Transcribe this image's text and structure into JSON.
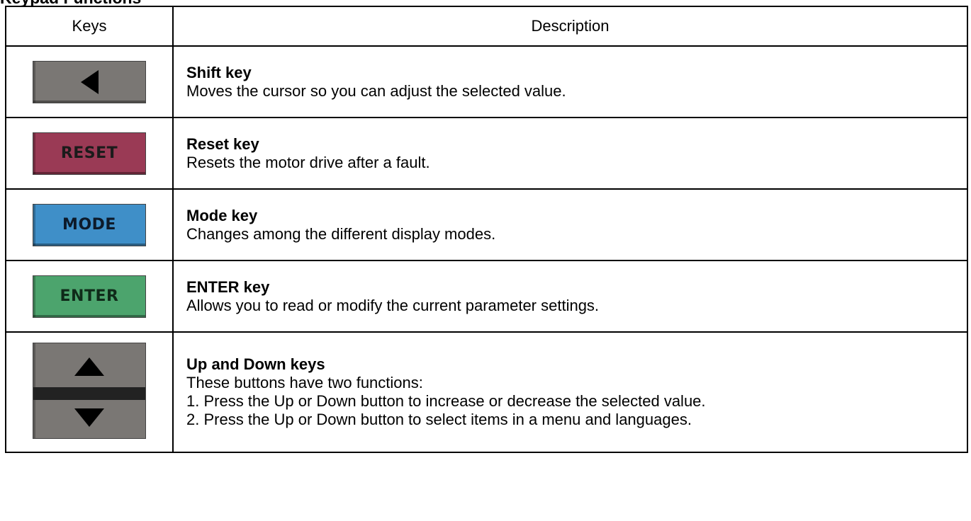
{
  "section_title": "Keypad Functions",
  "table": {
    "headers": [
      "Keys",
      "Description"
    ],
    "rows": [
      {
        "key_icon": "shift-left-arrow-key",
        "key_label": "",
        "key_color": "#7a7774",
        "title": "Shift key",
        "lines": [
          "Moves the cursor so you can adjust the selected value."
        ]
      },
      {
        "key_icon": "reset-key",
        "key_label": "RESET",
        "key_color": "#9a3a55",
        "title": "Reset key",
        "lines": [
          "Resets the motor drive after a fault."
        ]
      },
      {
        "key_icon": "mode-key",
        "key_label": "MODE",
        "key_color": "#3f8fc8",
        "title": "Mode key",
        "lines": [
          "Changes among the different display modes."
        ]
      },
      {
        "key_icon": "enter-key",
        "key_label": "ENTER",
        "key_color": "#4ca46d",
        "title": "ENTER key",
        "lines": [
          "Allows you to read or modify the current parameter settings."
        ]
      },
      {
        "key_icon": "up-down-keys",
        "key_label": "",
        "key_color": "#7a7774",
        "title": "Up and Down keys",
        "lines": [
          "These buttons have two functions:",
          "1. Press the Up or Down button to increase or decrease the selected value.",
          "2. Press the Up or Down button to select items in a menu and languages."
        ]
      }
    ]
  }
}
